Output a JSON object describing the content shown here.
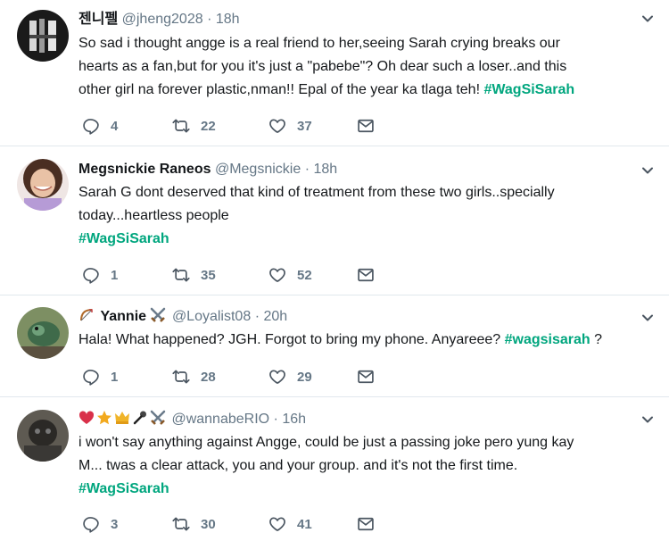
{
  "tweets": [
    {
      "name": "젠니펠",
      "handle": "@jheng2028",
      "time": "18h",
      "lines": [
        "So sad i thought angge is a real friend to her,seeing Sarah crying breaks our",
        "hearts as a fan,but for you it's just a \"pabebe\"? Oh dear such a loser..and this",
        "other girl na forever plastic,nman!! Epal of the year ka tlaga teh!"
      ],
      "hashtag": "#WagSiSarah",
      "replies": "4",
      "retweets": "22",
      "likes": "37"
    },
    {
      "name": "Megsnickie Raneos",
      "handle": "@Megsnickie",
      "time": "18h",
      "lines": [
        "Sarah G dont deserved that kind of treatment  from these two girls..specially",
        "today...heartless people"
      ],
      "hashtag": "#WagSiSarah",
      "replies": "1",
      "retweets": "35",
      "likes": "52"
    },
    {
      "name": "Yannie",
      "handle": "@Loyalist08",
      "time": "20h",
      "text": "Hala! What happened? JGH. Forgot to bring my phone. Anyareee?",
      "hashtag": "#wagsisarah",
      "suffix": "?",
      "replies": "1",
      "retweets": "28",
      "likes": "29"
    },
    {
      "handle": "@wannabeRIO",
      "time": "16h",
      "lines": [
        "i won't say anything against Angge, could be just a passing joke pero yung kay",
        "M... twas a clear attack, you and your group. and it's not the first time."
      ],
      "hashtag": "#WagSiSarah",
      "replies": "3",
      "retweets": "30",
      "likes": "41"
    }
  ],
  "separator": "·",
  "icons": {
    "reply": "reply-icon",
    "retweet": "retweet-icon",
    "like": "heart-icon",
    "dm": "envelope-icon",
    "caret": "chevron-down-icon"
  },
  "colors": {
    "hashtag": "#00a67e",
    "secondary": "#657786",
    "divider": "#e1e8ed"
  }
}
